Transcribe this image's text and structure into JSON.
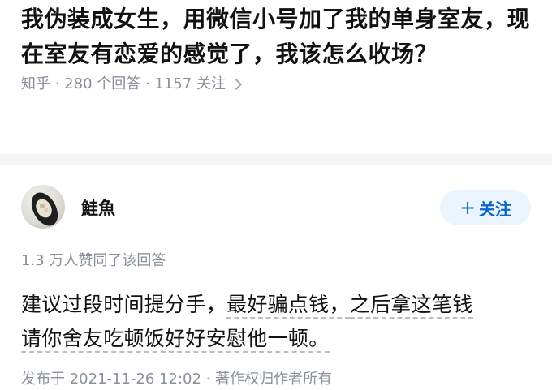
{
  "question": {
    "title": "我伪装成女生，用微信小号加了我的单身室友，现在室友有恋爱的感觉了，我该怎么收场？",
    "meta": "知乎 · 280 个回答 · 1157 关注",
    "chevron_icon": "chevron-right-icon"
  },
  "answer": {
    "author": {
      "name": "鮭魚",
      "avatar_icon": "user-avatar"
    },
    "follow_button_plus": "+",
    "follow_button_label": "关注",
    "vote_info": "1.3 万人赞同了该回答",
    "body_line1_part1": "建议过段时间提分手，",
    "body_line1_part2": "最好骗点钱，",
    "body_line1_part3": "之后拿这笔钱",
    "body_line2": "请你舍友吃顿饭好好安慰他一顿。",
    "publish_info": "发布于 2021-11-26 12:02 · 著作权归作者所有"
  },
  "colors": {
    "accent": "#0a66c7",
    "follow_bg": "#ebf5fd",
    "meta_text": "#8a8f99",
    "separator": "#f6f6f6"
  }
}
